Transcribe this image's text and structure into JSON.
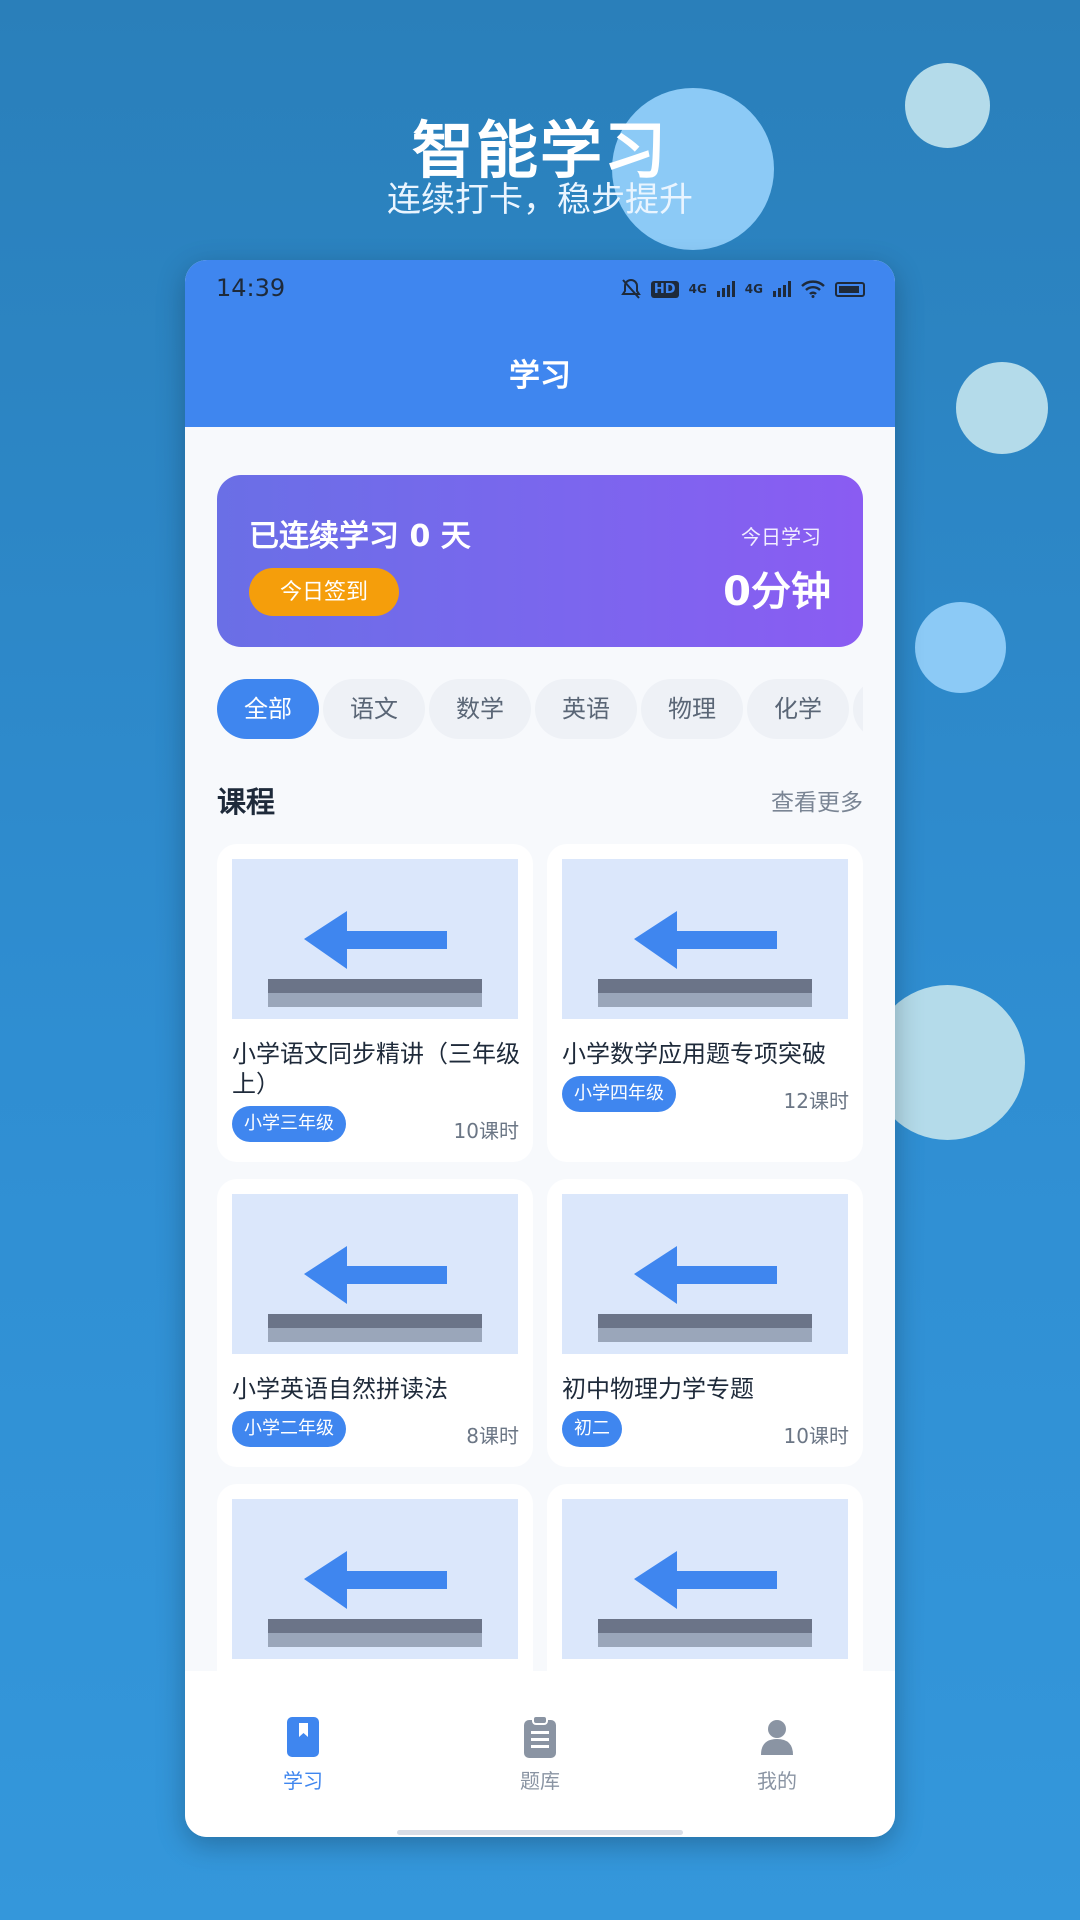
{
  "promo": {
    "title": "智能学习",
    "subtitle": "连续打卡，稳步提升"
  },
  "status_bar": {
    "time": "14:39",
    "icons": [
      "bell-off-icon",
      "hd-icon",
      "signal-4g-icon",
      "signal-4g-icon",
      "wifi-icon",
      "battery-icon"
    ],
    "hd_label": "HD",
    "net1": "4G",
    "net2": "4G"
  },
  "header": {
    "title": "学习"
  },
  "streak": {
    "text": "已连续学习 0 天",
    "checkin_label": "今日签到",
    "today_label": "今日学习",
    "today_value": "0分钟"
  },
  "subjects": [
    "全部",
    "语文",
    "数学",
    "英语",
    "物理",
    "化学"
  ],
  "active_subject": "全部",
  "courses_section": {
    "title": "课程",
    "more_label": "查看更多",
    "items": [
      {
        "title": "小学语文同步精讲（三年级上）",
        "grade": "小学三年级",
        "hours": "10课时"
      },
      {
        "title": "小学数学应用题专项突破",
        "grade": "小学四年级",
        "hours": "12课时"
      },
      {
        "title": "小学英语自然拼读法",
        "grade": "小学二年级",
        "hours": "8课时"
      },
      {
        "title": "初中物理力学专题",
        "grade": "初二",
        "hours": "10课时"
      }
    ]
  },
  "bottom_nav": {
    "items": [
      {
        "label": "学习",
        "icon": "book-icon",
        "active": true
      },
      {
        "label": "题库",
        "icon": "clipboard-icon",
        "active": false
      },
      {
        "label": "我的",
        "icon": "user-icon",
        "active": false
      }
    ]
  },
  "colors": {
    "accent": "#3f86ef",
    "checkin": "#f59e0b",
    "card_gradient_start": "#6a6fe6",
    "card_gradient_end": "#8a5cf2"
  }
}
